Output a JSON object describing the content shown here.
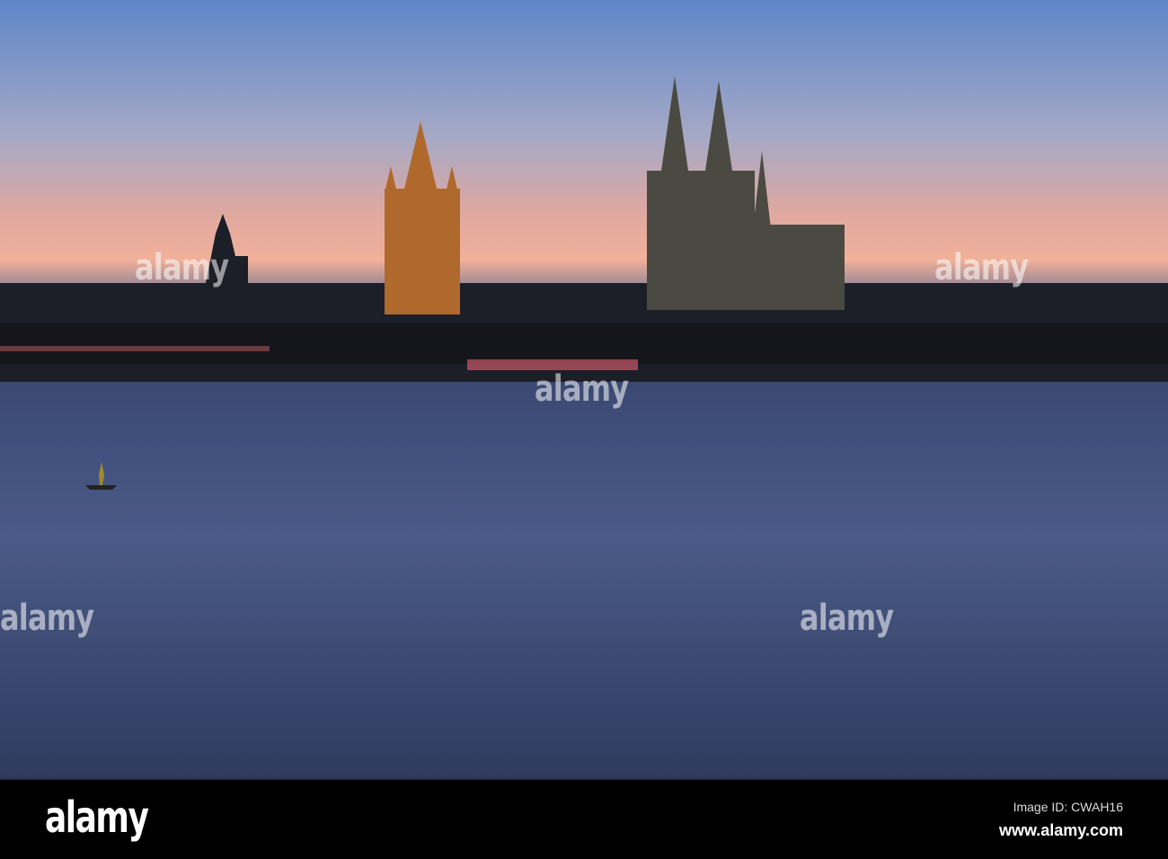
{
  "watermark": {
    "brand": "alamy"
  },
  "footer": {
    "logo": "alamy",
    "image_id": "Image ID: CWAH16",
    "url": "www.alamy.com"
  }
}
